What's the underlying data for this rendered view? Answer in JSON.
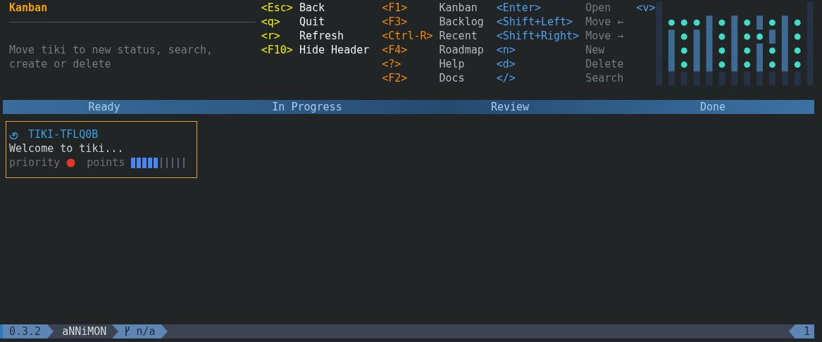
{
  "view": {
    "title": "Kanban",
    "description": "Move tiki to new status, search, create or delete"
  },
  "shortcut_groups": [
    {
      "kind": "global",
      "items": [
        {
          "key": "<Esc>",
          "label": "Back"
        },
        {
          "key": "<q>",
          "label": "Quit"
        },
        {
          "key": "<r>",
          "label": "Refresh"
        },
        {
          "key": "<F10>",
          "label": "Hide Header"
        }
      ]
    },
    {
      "kind": "views",
      "items": [
        {
          "key": "<F1>",
          "label": "Kanban"
        },
        {
          "key": "<F3>",
          "label": "Backlog"
        },
        {
          "key": "<Ctrl-R>",
          "label": "Recent"
        },
        {
          "key": "<F4>",
          "label": "Roadmap"
        },
        {
          "key": "<?>",
          "label": "Help"
        },
        {
          "key": "<F2>",
          "label": "Docs"
        }
      ]
    },
    {
      "kind": "actions",
      "items": [
        {
          "key": "<Enter>",
          "label": "Open"
        },
        {
          "key": "<Shift+Left>",
          "label": "Move ←"
        },
        {
          "key": "<Shift+Right>",
          "label": "Move →"
        },
        {
          "key": "<n>",
          "label": "New"
        },
        {
          "key": "<d>",
          "label": "Delete"
        },
        {
          "key": "</>",
          "label": "Search"
        }
      ]
    },
    {
      "kind": "actions",
      "items": [
        {
          "key": "<v>"
        }
      ]
    }
  ],
  "columns": [
    {
      "title": "Ready",
      "cards": [
        {
          "id": "TIKI-TFLQ0B",
          "title": "Welcome to tiki...",
          "priority_label": "priority",
          "color": "#e8322e",
          "points_label": "points",
          "level": 0.5
        }
      ]
    },
    {
      "title": "In Progress"
    },
    {
      "title": "Review"
    },
    {
      "title": "Done"
    }
  ],
  "status_bar": {
    "version": "0.3.2",
    "user": "aNNiMON",
    "branch": "n/a",
    "count": "1"
  }
}
